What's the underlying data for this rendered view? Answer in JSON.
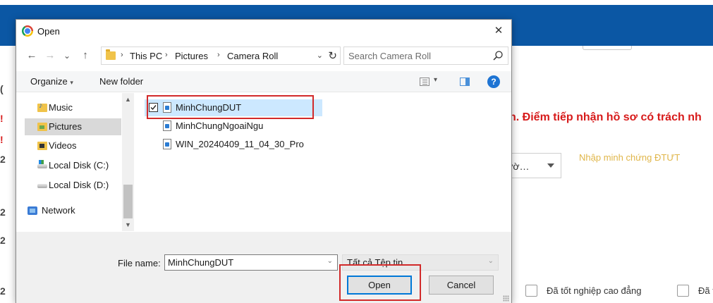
{
  "background": {
    "notice_text": "n. Điểm tiếp nhận hồ sơ có trách nh",
    "select_text": "ườ…",
    "link_text": "Nhập minh chứng ĐTƯT",
    "checkbox_labels": [
      "Đã tốt nghiệp cao đẳng",
      "Đã t"
    ],
    "left_marks": [
      "(",
      "!",
      "!",
      "2",
      "2",
      "2",
      "2"
    ]
  },
  "dialog": {
    "title": "Open",
    "close_glyph": "✕",
    "nav": {
      "back_glyph": "←",
      "forward_glyph": "→",
      "recent_glyph": "⌄",
      "up_glyph": "↑",
      "breadcrumb": [
        "This PC",
        "Pictures",
        "Camera Roll"
      ],
      "breadcrumb_separator": "›",
      "dropdown_glyph": "⌄",
      "refresh_glyph": "↻"
    },
    "search": {
      "placeholder": "Search Camera Roll"
    },
    "toolbar": {
      "organize_label": "Organize",
      "organize_caret": "▾",
      "new_folder_label": "New folder",
      "view_caret": "▾",
      "help_glyph": "?"
    },
    "nav_pane": {
      "items": [
        {
          "label": "Music",
          "icon": "music-folder-icon"
        },
        {
          "label": "Pictures",
          "icon": "pictures-folder-icon",
          "selected": true
        },
        {
          "label": "Videos",
          "icon": "videos-folder-icon"
        },
        {
          "label": "Local Disk (C:)",
          "icon": "local-disk-c-icon"
        },
        {
          "label": "Local Disk (D:)",
          "icon": "local-disk-d-icon"
        },
        {
          "label": "Network",
          "icon": "network-icon"
        }
      ],
      "scroll_up_glyph": "▲",
      "scroll_down_glyph": "▼"
    },
    "files": [
      {
        "name": "MinhChungDUT",
        "selected": true,
        "checked": true
      },
      {
        "name": "MinhChungNgoaiNgu",
        "selected": false
      },
      {
        "name": "WIN_20240409_11_04_30_Pro",
        "selected": false
      }
    ],
    "file_name_label": "File name:",
    "file_name_value": "MinhChungDUT",
    "file_name_dropdown_glyph": "⌄",
    "file_type_filter": "Tất cả Tệp tin",
    "file_type_dropdown_glyph": "⌄",
    "open_button": "Open",
    "cancel_button": "Cancel"
  },
  "colors": {
    "accent_blue": "#0b57a4",
    "highlight_red": "#d22a2a",
    "selection_blue": "#cce8ff",
    "default_button_border": "#0078d7",
    "notice_red": "#d71a1a",
    "link_gold": "#e0b64a"
  }
}
